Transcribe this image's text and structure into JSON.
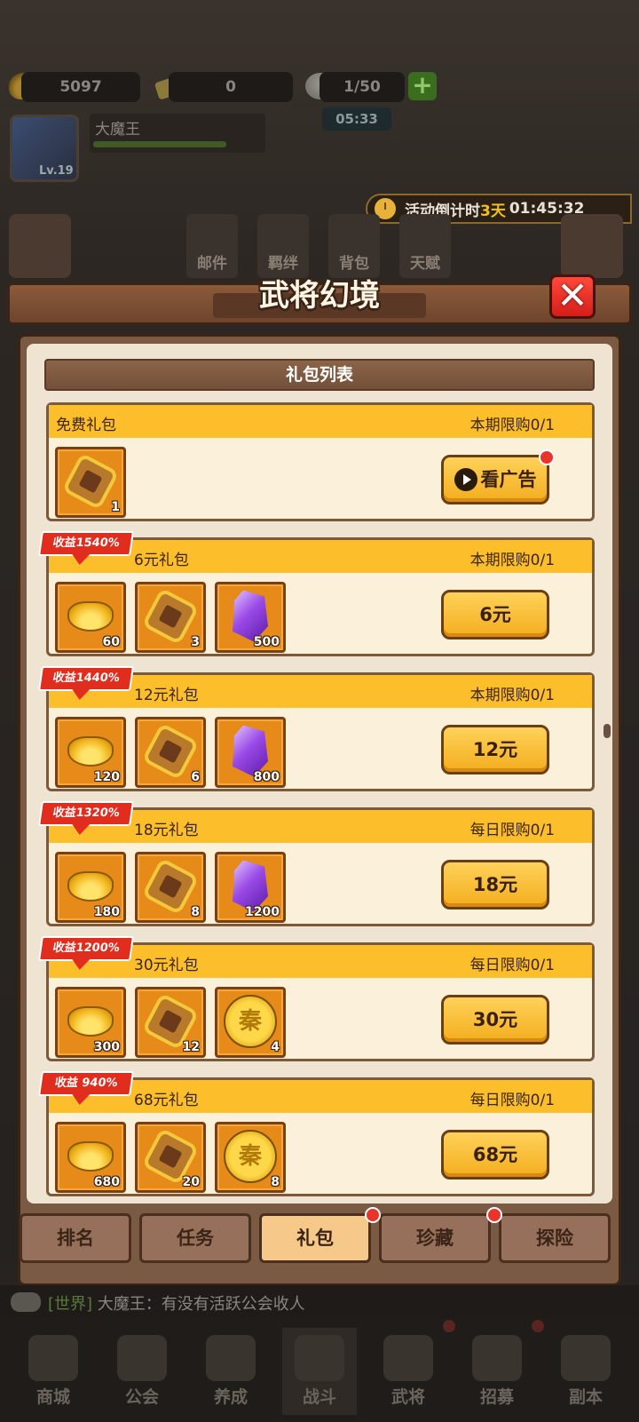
{
  "background": {
    "resources": {
      "gold": "5097",
      "tickets": "0",
      "energy": "1/50"
    },
    "timer": "05:33",
    "player": {
      "name": "大魔王",
      "level": "Lv.19"
    },
    "countdown": {
      "label": "活动倒计时",
      "days": "3天",
      "time": "01:45:32"
    },
    "menu_buttons": [
      "邮件",
      "羁绊",
      "背包",
      "天赋"
    ]
  },
  "modal": {
    "title": "武将幻境",
    "close_glyph": "✕",
    "section_title": "礼包列表",
    "gifts": [
      {
        "name": "免费礼包",
        "limit": "本期限购0/1",
        "ribbon": "",
        "button": "看广告",
        "items": [
          {
            "icon": "token-icon",
            "count": "1"
          }
        ]
      },
      {
        "name": "6元礼包",
        "limit": "本期限购0/1",
        "ribbon": "收益1540%",
        "button": "6元",
        "items": [
          {
            "icon": "gold-ingot-icon",
            "count": "60"
          },
          {
            "icon": "token-icon",
            "count": "3"
          },
          {
            "icon": "purple-gem-icon",
            "count": "500"
          }
        ]
      },
      {
        "name": "12元礼包",
        "limit": "本期限购0/1",
        "ribbon": "收益1440%",
        "button": "12元",
        "items": [
          {
            "icon": "gold-ingot-icon",
            "count": "120"
          },
          {
            "icon": "token-icon",
            "count": "6"
          },
          {
            "icon": "purple-gem-icon",
            "count": "800"
          }
        ]
      },
      {
        "name": "18元礼包",
        "limit": "每日限购0/1",
        "ribbon": "收益1320%",
        "button": "18元",
        "items": [
          {
            "icon": "gold-ingot-icon",
            "count": "180"
          },
          {
            "icon": "token-icon",
            "count": "8"
          },
          {
            "icon": "purple-gem-icon",
            "count": "1200"
          }
        ]
      },
      {
        "name": "30元礼包",
        "limit": "每日限购0/1",
        "ribbon": "收益1200%",
        "button": "30元",
        "items": [
          {
            "icon": "gold-ingot-icon",
            "count": "300"
          },
          {
            "icon": "token-icon",
            "count": "12"
          },
          {
            "icon": "qin-coin-icon",
            "count": "4"
          }
        ]
      },
      {
        "name": "68元礼包",
        "limit": "每日限购0/1",
        "ribbon": "收益 940%",
        "button": "68元",
        "items": [
          {
            "icon": "gold-ingot-icon",
            "count": "680"
          },
          {
            "icon": "token-icon",
            "count": "20"
          },
          {
            "icon": "qin-coin-icon",
            "count": "8"
          }
        ]
      }
    ],
    "coin_glyph": "秦"
  },
  "tabs": [
    {
      "label": "排名",
      "active": false
    },
    {
      "label": "任务",
      "active": false
    },
    {
      "label": "礼包",
      "active": true
    },
    {
      "label": "珍藏",
      "active": false
    },
    {
      "label": "探险",
      "active": false
    }
  ],
  "chat": {
    "channel": "[世界]",
    "message": "大魔王：有没有活跃公会收人"
  },
  "nav": [
    "商城",
    "公会",
    "养成",
    "战斗",
    "武将",
    "招募",
    "副本"
  ],
  "colors": {
    "accent_yellow": "#fcbe2a",
    "ribbon_red": "#e02d1e",
    "panel_brown": "#7a5a43",
    "active_tab": "#f6c889"
  }
}
